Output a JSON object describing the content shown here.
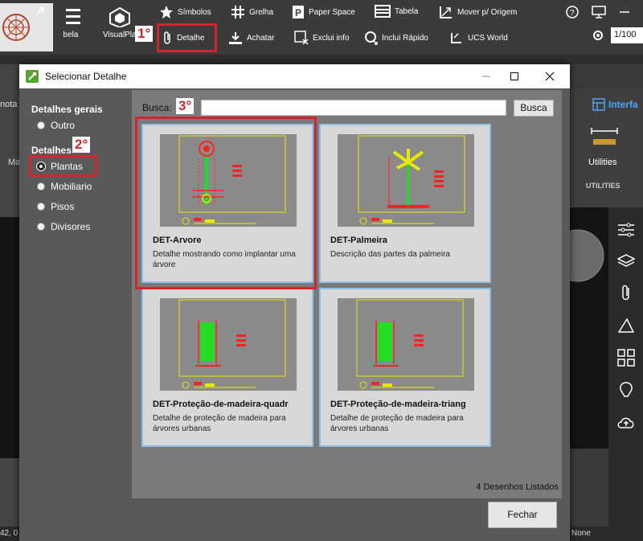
{
  "ribbon": {
    "simbolos": "Símbolos",
    "grelha": "Grelha",
    "paper_space": "Paper Space",
    "tabela": "Tabela",
    "mover": "Mover p/ Origem",
    "detalhe": "Detalhe",
    "achatar": "Achatar",
    "exclui_info": "Exclui info",
    "inclui_rapido": "Inclui Rápido",
    "ucs_world": "UCS World",
    "visualpla": "VisualPla",
    "bela": "bela",
    "zoom": "1/100"
  },
  "background": {
    "interface_label": "Interfa",
    "utilities_label": "Utilities",
    "utilities_caps": "UTILITIES",
    "left_nota": "nota",
    "left_ma": "Ma",
    "status_left": "42, 0",
    "status_none": "None"
  },
  "dialog": {
    "title": "Selecionar Detalhe",
    "sidebar": {
      "group1": "Detalhes gerais",
      "outro": "Outro",
      "group2": "Detalhes",
      "plantas": "Plantas",
      "mobiliario": "Mobiliario",
      "pisos": "Pisos",
      "divisores": "Divisores"
    },
    "search_label": "Busca:",
    "search_value": "",
    "search_button": "Busca",
    "cards": [
      {
        "name": "DET-Arvore",
        "desc": "Detalhe mostrando como implantar uma árvore"
      },
      {
        "name": "DET-Palmeira",
        "desc": "Descrição das partes da palmeira"
      },
      {
        "name": "DET-Proteção-de-madeira-quadr",
        "desc": "Detalhe de proteção de madeira para árvores urbanas"
      },
      {
        "name": "DET-Proteção-de-madeira-triang",
        "desc": "Detalhe de proteção de madeira para árvores urbanas"
      }
    ],
    "count": "4 Desenhos Listados",
    "close_button": "Fechar"
  },
  "annotations": {
    "step1": "1°",
    "step2": "2°",
    "step3": "3°"
  },
  "colors": {
    "highlight": "#d2262e",
    "card_border": "#8fbfe8"
  }
}
